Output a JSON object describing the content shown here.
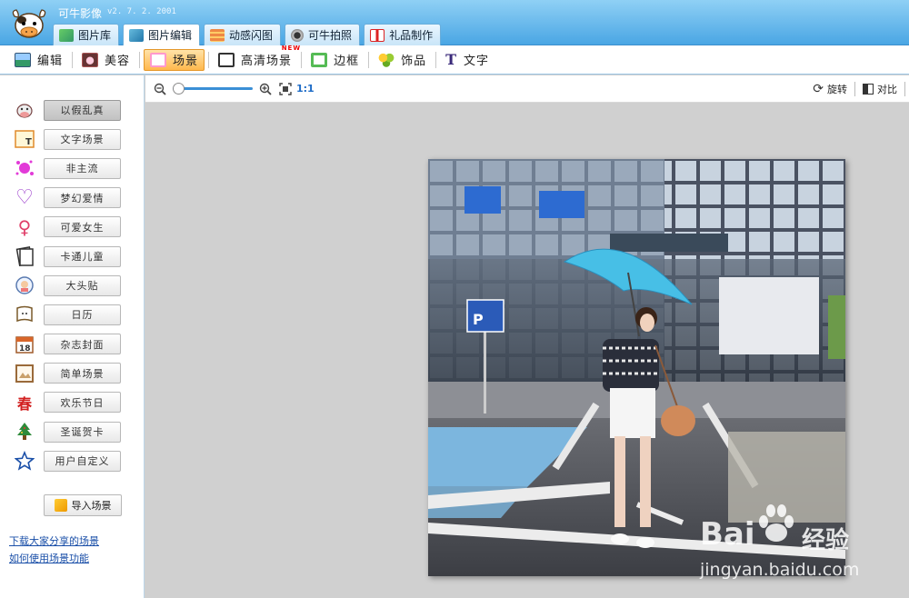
{
  "app": {
    "title": "可牛影像",
    "version": "v2. 7. 2. 2001"
  },
  "main_tabs": [
    {
      "label": "图片库",
      "icon": "image-library-icon",
      "active": false
    },
    {
      "label": "图片编辑",
      "icon": "image-edit-icon",
      "active": true
    },
    {
      "label": "动感闪图",
      "icon": "flash-image-icon",
      "active": false
    },
    {
      "label": "可牛拍照",
      "icon": "webcam-icon",
      "active": false
    },
    {
      "label": "礼品制作",
      "icon": "gift-icon",
      "active": false
    }
  ],
  "sub_toolbar": {
    "edit": "编辑",
    "beauty": "美容",
    "scene": "场景",
    "hd_scene": "高清场景",
    "hd_badge": "NEW",
    "frame": "边框",
    "decoration": "饰品",
    "text": "文字"
  },
  "scenes": [
    {
      "label": "以假乱真",
      "icon": "cow-head-icon",
      "active": true
    },
    {
      "label": "文字场景",
      "icon": "text-scene-icon",
      "active": false
    },
    {
      "label": "非主流",
      "icon": "splash-icon",
      "active": false
    },
    {
      "label": "梦幻爱情",
      "icon": "heart-icon",
      "active": false
    },
    {
      "label": "可爱女生",
      "icon": "female-icon",
      "active": false
    },
    {
      "label": "卡通儿童",
      "icon": "book-icon",
      "active": false
    },
    {
      "label": "大头贴",
      "icon": "sticker-icon",
      "active": false
    },
    {
      "label": "日历",
      "icon": "calendar-page-icon",
      "active": false
    },
    {
      "label": "杂志封面",
      "icon": "calendar-18-icon",
      "active": false
    },
    {
      "label": "简单场景",
      "icon": "frame-icon",
      "active": false
    },
    {
      "label": "欢乐节日",
      "icon": "spring-icon",
      "active": false
    },
    {
      "label": "圣诞贺卡",
      "icon": "tree-icon",
      "active": false
    },
    {
      "label": "用户自定义",
      "icon": "star-icon",
      "active": false
    }
  ],
  "scene_icon_glyphs": {
    "heart": "♡",
    "female": "♀",
    "star": "☆",
    "spring": "春",
    "tree": "⛄"
  },
  "import_button": "导入场景",
  "links": {
    "download": "下载大家分享的场景",
    "howto": "如何使用场景功能"
  },
  "editor": {
    "zoom_ratio": "1:1",
    "zoom_level": 0,
    "rotate": "旋转",
    "compare": "对比"
  },
  "watermark": {
    "main": "Bai",
    "cn": "经验",
    "url": "jingyan.baidu.com"
  },
  "colors": {
    "accent": "#4aa6e4",
    "active_orange": "#ffb84d",
    "link": "#1a4fa8",
    "canvas_bg": "#d0d0d0"
  }
}
